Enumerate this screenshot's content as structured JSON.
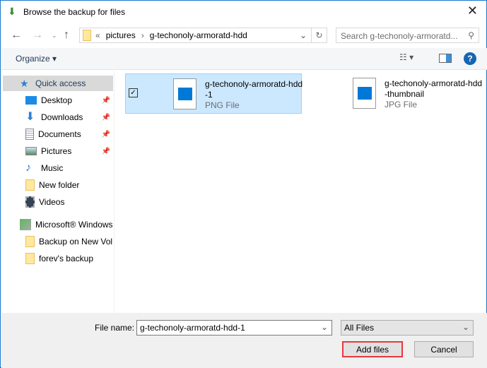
{
  "title": "Browse the backup for files",
  "breadcrumb": {
    "overflow": "«",
    "items": [
      "pictures",
      "g-techonoly-armoratd-hdd"
    ]
  },
  "search": {
    "placeholder": "Search g-techonoly-armoratd..."
  },
  "toolbar": {
    "organize": "Organize ▾"
  },
  "sidebar": {
    "items": [
      {
        "label": "Quick access",
        "icon": "star-icon"
      },
      {
        "label": "Desktop",
        "icon": "desktop-icon",
        "pinned": true
      },
      {
        "label": "Downloads",
        "icon": "download-icon",
        "pinned": true
      },
      {
        "label": "Documents",
        "icon": "document-icon",
        "pinned": true
      },
      {
        "label": "Pictures",
        "icon": "pictures-icon",
        "pinned": true
      },
      {
        "label": "Music",
        "icon": "music-icon"
      },
      {
        "label": "New folder",
        "icon": "folder-icon"
      },
      {
        "label": "Videos",
        "icon": "video-icon"
      },
      {
        "label": "Microsoft® Windows",
        "icon": "backup-icon"
      },
      {
        "label": "Backup on New Vol",
        "icon": "folder-icon"
      },
      {
        "label": "forev's backup",
        "icon": "folder-icon"
      }
    ]
  },
  "files": [
    {
      "name": "g-techonoly-armoratd-hdd-1",
      "type": "PNG File",
      "selected": true
    },
    {
      "name": "g-techonoly-armoratd-hdd-thumbnail",
      "type": "JPG File",
      "selected": false
    }
  ],
  "footer": {
    "file_name_label": "File name:",
    "file_name_value": "g-techonoly-armoratd-hdd-1",
    "filter": "All Files",
    "add": "Add files",
    "cancel": "Cancel"
  }
}
